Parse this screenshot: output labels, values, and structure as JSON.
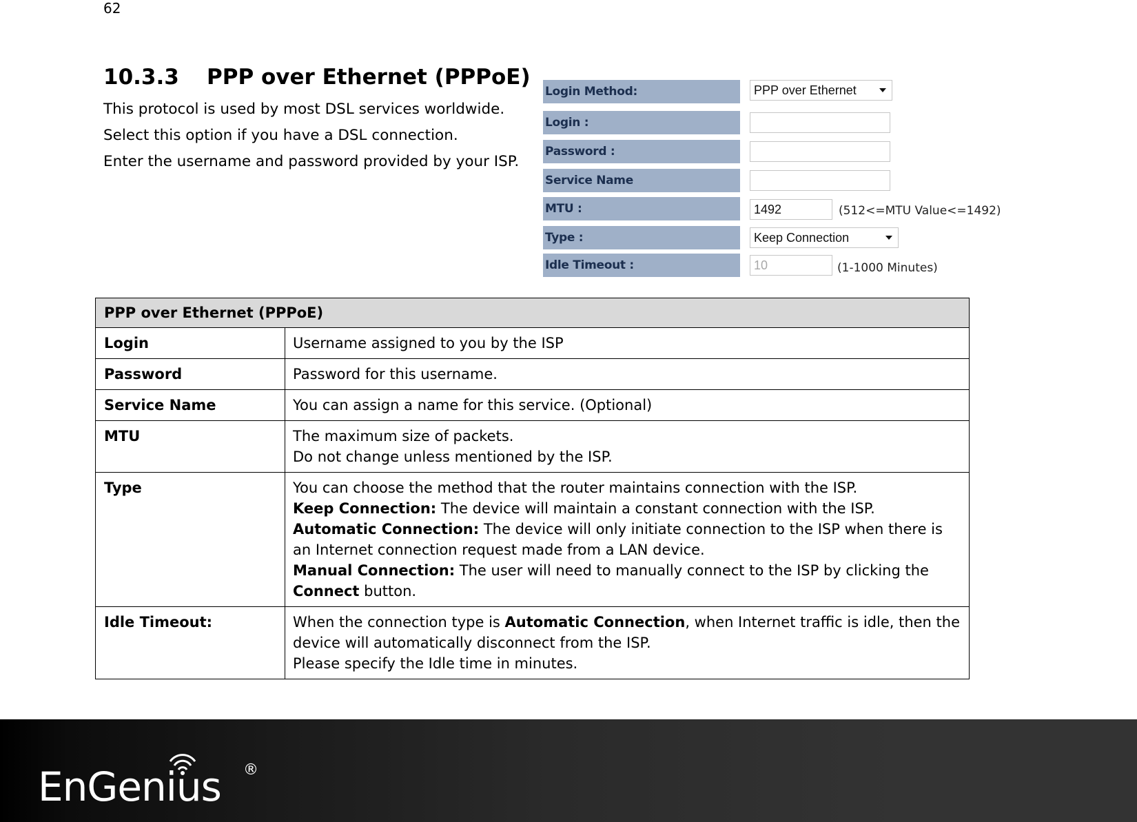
{
  "page_number": "62",
  "section": {
    "number": "10.3.3",
    "title": "PPP over Ethernet (PPPoE)",
    "intro_lines": [
      "This protocol is used by most DSL services worldwide.",
      "Select this option if you have a DSL connection.",
      "Enter the username and password provided by your ISP."
    ]
  },
  "form": {
    "login_method": {
      "label": "Login Method:",
      "value": "PPP over Ethernet"
    },
    "login": {
      "label": "Login :",
      "value": ""
    },
    "password": {
      "label": "Password :",
      "value": ""
    },
    "service_name": {
      "label": "Service Name",
      "value": ""
    },
    "mtu": {
      "label": "MTU :",
      "value": "1492",
      "hint": "(512<=MTU Value<=1492)"
    },
    "type": {
      "label": "Type :",
      "value": "Keep Connection"
    },
    "idle_timeout": {
      "label": "Idle Timeout :",
      "value": "10",
      "hint": "(1-1000 Minutes)"
    }
  },
  "table": {
    "header": "PPP over Ethernet (PPPoE)",
    "rows": [
      {
        "key": "Login",
        "lines": [
          "Username assigned to you by the ISP"
        ]
      },
      {
        "key": "Password",
        "lines": [
          "Password for this username."
        ]
      },
      {
        "key": "Service Name",
        "lines": [
          "You can assign a name for this service. (Optional)"
        ]
      },
      {
        "key": "MTU",
        "lines": [
          "The maximum size of packets.",
          "Do not change unless mentioned by the ISP."
        ]
      },
      {
        "key": "Type",
        "intro": "You can choose the method that the router maintains connection with the ISP.",
        "keep_label": "Keep Connection:",
        "keep_text": " The device will maintain a constant connection with the ISP.",
        "auto_label": "Automatic Connection:",
        "auto_text": " The device will only initiate connection to the ISP when there is an Internet connection request made from a LAN device.",
        "manual_label": "Manual Connection:",
        "manual_text": " The user will need to manually connect to the ISP by clicking the ",
        "manual_button": "Connect",
        "manual_tail": " button."
      },
      {
        "key": "Idle Timeout:",
        "pre": "When the connection type is ",
        "bold": "Automatic Connection",
        "post": ", when Internet traffic is idle, then the device will automatically disconnect from the ISP.",
        "line2": "Please specify the Idle time in minutes."
      }
    ]
  },
  "footer": {
    "brand": "EnGenius",
    "registered": "®"
  }
}
